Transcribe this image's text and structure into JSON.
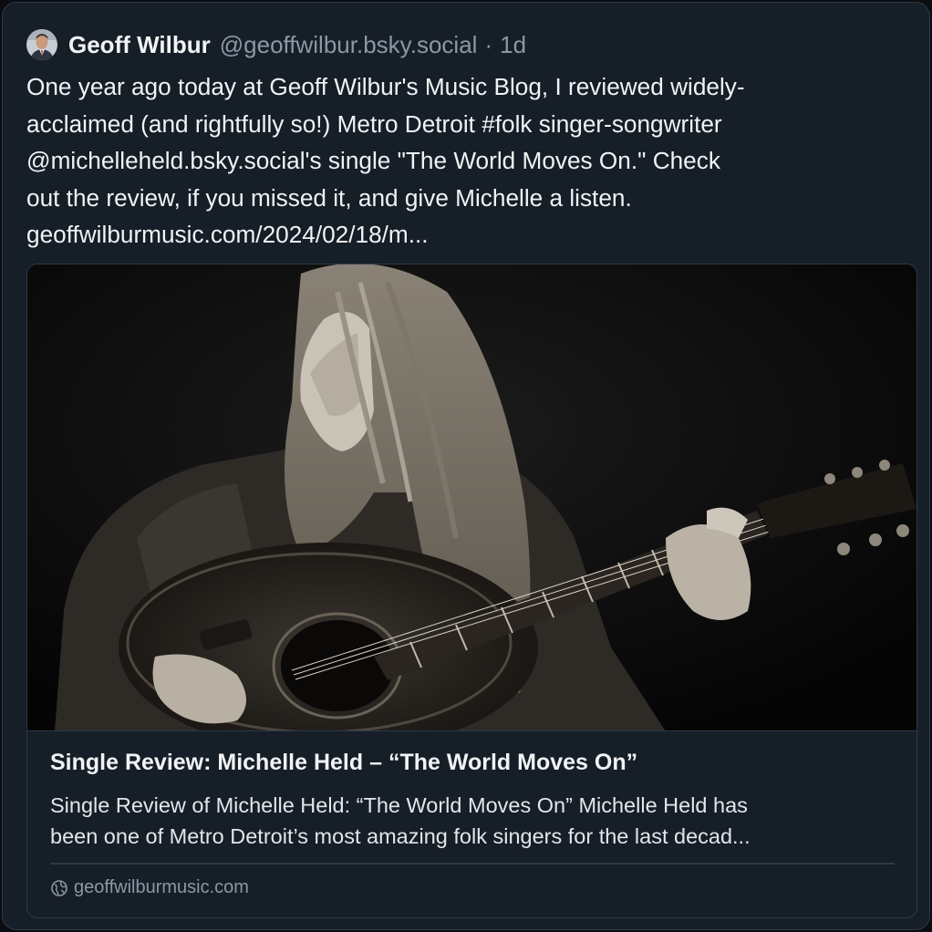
{
  "post": {
    "author_name": "Geoff Wilbur",
    "handle": "@geoffwilbur.bsky.social",
    "separator": "·",
    "time": "1d",
    "text_lines": [
      "One year ago today at Geoff Wilbur's Music Blog, I reviewed widely-",
      "acclaimed (and rightfully so!) Metro Detroit #folk singer-songwriter",
      "@michelleheld.bsky.social's single \"The World Moves On.\" Check",
      "out the review, if you missed it, and give Michelle a listen.",
      "geoffwilburmusic.com/2024/02/18/m..."
    ]
  },
  "link_card": {
    "image_icon": "photo-of-woman-playing-acoustic-guitar",
    "title": "Single Review: Michelle Held – “The World Moves On”",
    "description_lines": [
      "Single Review of Michelle Held: “The World Moves On” Michelle Held has",
      "been one of Metro Detroit’s most amazing folk singers for the last decad..."
    ],
    "source_icon": "globe-icon",
    "source": "geoffwilburmusic.com"
  },
  "colors": {
    "background": "#161e27",
    "border": "#2e3a48",
    "text": "#f1f3f5",
    "muted": "#8b98a5"
  }
}
